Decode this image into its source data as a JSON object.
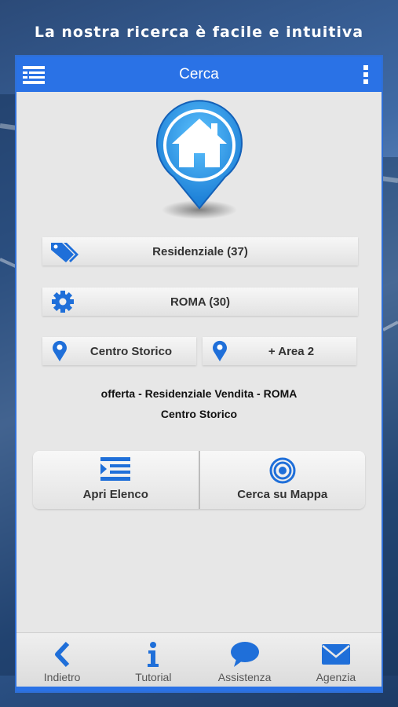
{
  "headline": "La nostra ricerca è facile e intuitiva",
  "topbar": {
    "title": "Cerca"
  },
  "filters": {
    "category": "Residenziale (37)",
    "city": "ROMA (30)",
    "area1": "Centro Storico",
    "area2": "+ Area 2"
  },
  "summary": {
    "line1": "offerta - Residenziale Vendita - ROMA",
    "line2": "Centro Storico"
  },
  "actions": {
    "list_label": "Apri Elenco",
    "map_label": "Cerca su Mappa"
  },
  "tabs": [
    {
      "label": "Indietro",
      "icon": "back-arrow-icon"
    },
    {
      "label": "Tutorial",
      "icon": "info-icon"
    },
    {
      "label": "Assistenza",
      "icon": "chat-bubble-icon"
    },
    {
      "label": "Agenzia",
      "icon": "envelope-icon"
    }
  ],
  "colors": {
    "accent": "#2a72e6",
    "icon_blue": "#1f6fd9"
  }
}
